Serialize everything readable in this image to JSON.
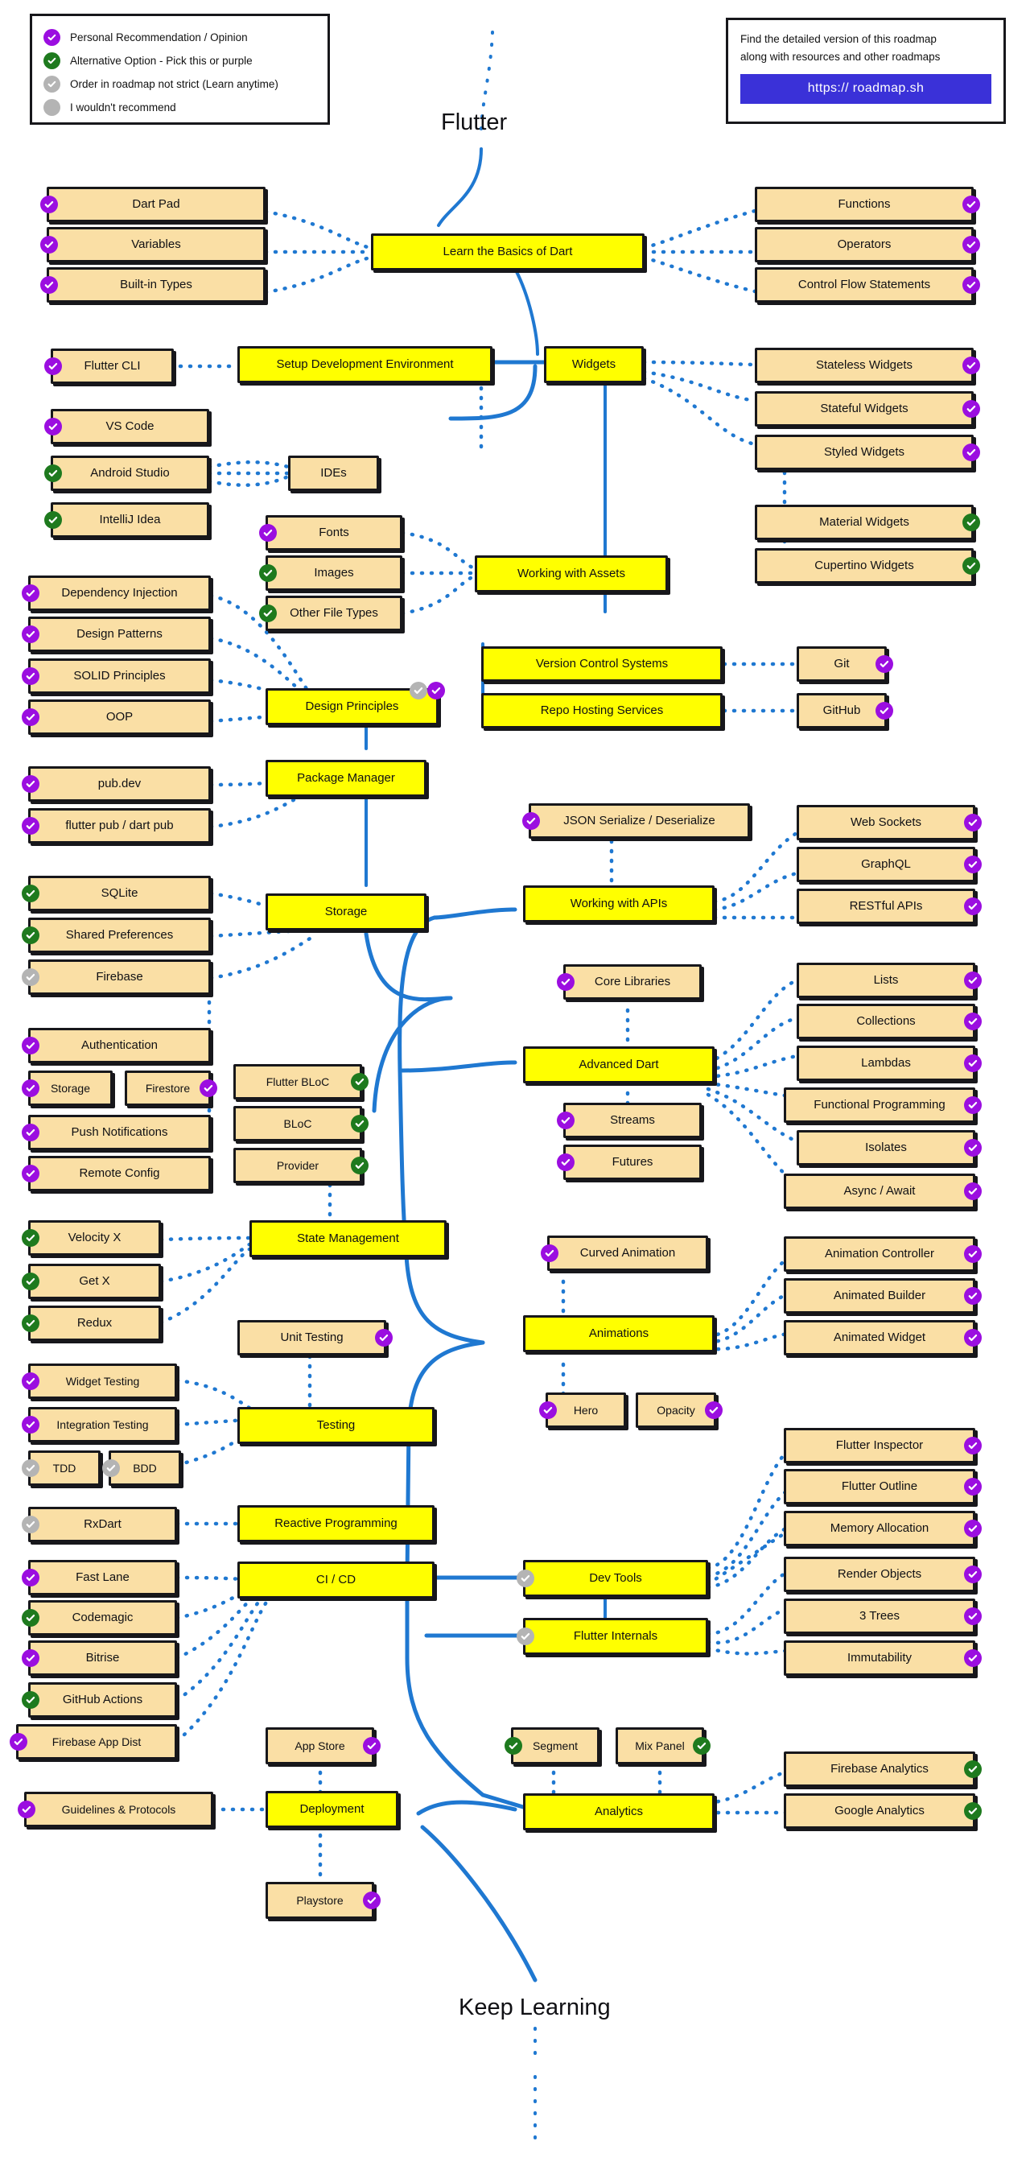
{
  "meta": {
    "title": "Flutter",
    "footer_title": "Keep Learning"
  },
  "colors": {
    "node_fill": "#FADFA5",
    "primary_fill": "#FFFF00",
    "border": "#17171B",
    "badge_purple": "#9B0EE0",
    "badge_green": "#1E7A1E",
    "badge_gray": "#B4B4B4",
    "edge_solid": "#1F78D1",
    "edge_dotted": "#1F78D1",
    "cta_button": "#3A31D8"
  },
  "legend": {
    "items": [
      {
        "badge": "purple",
        "icon": "check-circle-icon",
        "label": "Personal Recommendation / Opinion"
      },
      {
        "badge": "green",
        "icon": "check-circle-icon",
        "label": "Alternative Option - Pick this or purple"
      },
      {
        "badge": "gray",
        "icon": "check-circle-icon",
        "label": "Order in roadmap not strict (Learn anytime)"
      },
      {
        "badge": "gray",
        "icon": "plain-circle-icon",
        "label": "I wouldn't recommend"
      }
    ]
  },
  "info_card": {
    "line1": "Find the detailed version of this roadmap",
    "line2": "along with resources and other roadmaps",
    "button_label": "https:// roadmap.sh"
  },
  "nodes": {
    "learn_basics_dart": "Learn the Basics of Dart",
    "dart_pad": "Dart Pad",
    "variables": "Variables",
    "builtin_types": "Built-in Types",
    "functions": "Functions",
    "operators": "Operators",
    "control_flow": "Control Flow Statements",
    "setup_env": "Setup Development Environment",
    "flutter_cli": "Flutter CLI",
    "vs_code": "VS Code",
    "android_studio": "Android Studio",
    "intellij_idea": "IntelliJ Idea",
    "ides": "IDEs",
    "widgets": "Widgets",
    "stateless_widgets": "Stateless Widgets",
    "stateful_widgets": "Stateful Widgets",
    "styled_widgets": "Styled Widgets",
    "material_widgets": "Material Widgets",
    "cupertino_widgets": "Cupertino Widgets",
    "working_with_assets": "Working with Assets",
    "fonts": "Fonts",
    "images": "Images",
    "other_file_types": "Other File Types",
    "version_control": "Version Control Systems",
    "repo_hosting": "Repo Hosting Services",
    "git": "Git",
    "github": "GitHub",
    "design_principles": "Design Principles",
    "dependency_injection": "Dependency Injection",
    "design_patterns": "Design Patterns",
    "solid_principles": "SOLID Principles",
    "oop": "OOP",
    "package_manager": "Package Manager",
    "pub_dev": "pub.dev",
    "flutter_pub": "flutter pub / dart pub",
    "storage": "Storage",
    "sqlite": "SQLite",
    "shared_preferences": "Shared Preferences",
    "firebase": "Firebase",
    "authentication": "Authentication",
    "auth_storage": "Storage",
    "firestore": "Firestore",
    "push_notifications": "Push Notifications",
    "remote_config": "Remote Config",
    "working_with_apis": "Working with APIs",
    "json_serialize": "JSON Serialize / Deserialize",
    "web_sockets": "Web Sockets",
    "graphql": "GraphQL",
    "restful_apis": "RESTful APIs",
    "advanced_dart": "Advanced Dart",
    "core_libraries": "Core Libraries",
    "streams": "Streams",
    "futures": "Futures",
    "lists": "Lists",
    "collections": "Collections",
    "lambdas": "Lambdas",
    "functional_programming": "Functional Programming",
    "isolates": "Isolates",
    "async_await": "Async / Await",
    "state_management": "State Management",
    "flutter_bloc": "Flutter BLoC",
    "bloc": "BLoC",
    "provider": "Provider",
    "velocity_x": "Velocity X",
    "get_x": "Get X",
    "redux": "Redux",
    "animations": "Animations",
    "curved_animation": "Curved Animation",
    "animation_controller": "Animation Controller",
    "animated_builder": "Animated Builder",
    "animated_widget": "Animated Widget",
    "hero": "Hero",
    "opacity": "Opacity",
    "testing": "Testing",
    "unit_testing": "Unit Testing",
    "widget_testing": "Widget Testing",
    "integration_testing": "Integration Testing",
    "tdd": "TDD",
    "bdd": "BDD",
    "reactive_programming": "Reactive Programming",
    "rxdart": "RxDart",
    "dev_tools": "Dev Tools",
    "flutter_inspector": "Flutter Inspector",
    "flutter_outline": "Flutter Outline",
    "memory_allocation": "Memory Allocation",
    "flutter_internals": "Flutter Internals",
    "render_objects": "Render Objects",
    "three_trees": "3 Trees",
    "immutability": "Immutability",
    "ci_cd": "CI / CD",
    "fast_lane": "Fast Lane",
    "codemagic": "Codemagic",
    "bitrise": "Bitrise",
    "github_actions": "GitHub Actions",
    "firebase_app_dist": "Firebase App Dist",
    "deployment": "Deployment",
    "guidelines_protocols": "Guidelines & Protocols",
    "app_store": "App Store",
    "playstore": "Playstore",
    "analytics": "Analytics",
    "segment": "Segment",
    "mix_panel": "Mix Panel",
    "firebase_analytics": "Firebase Analytics",
    "google_analytics": "Google Analytics"
  }
}
